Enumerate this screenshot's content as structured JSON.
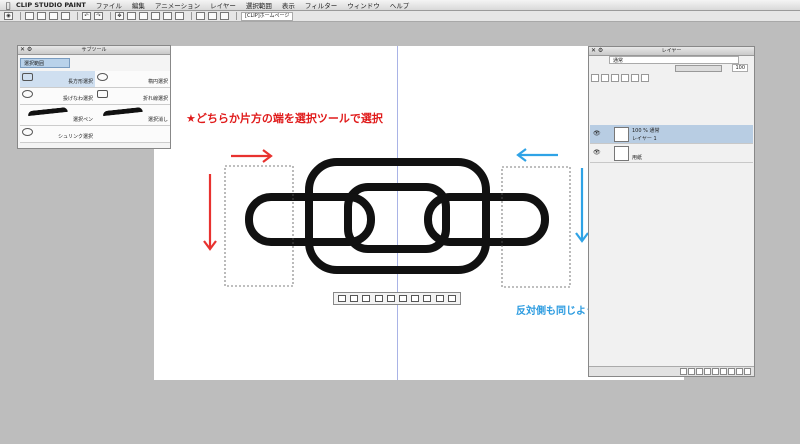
{
  "menubar": {
    "app_name": "CLIP STUDIO PAINT",
    "items": [
      "ファイル",
      "編集",
      "アニメーション",
      "レイヤー",
      "選択範囲",
      "表示",
      "フィルター",
      "ウィンドウ",
      "ヘルプ"
    ]
  },
  "toolbar": {
    "document_tab": "[CLIP]ホームページ"
  },
  "subtool_palette": {
    "title": "サブツール",
    "group_label": "選択範囲",
    "tools": [
      {
        "label": "長方形選択",
        "active": true
      },
      {
        "label": "楕円選択",
        "active": false
      },
      {
        "label": "投げなわ選択",
        "active": false
      },
      {
        "label": "折れ線選択",
        "active": false
      },
      {
        "label": "選択ペン",
        "active": false
      },
      {
        "label": "選択消し",
        "active": false
      },
      {
        "label": "シュリンク選択",
        "active": false
      }
    ]
  },
  "layer_palette": {
    "title": "レイヤー",
    "blend_mode": "通常",
    "opacity": "100",
    "layers": [
      {
        "opacity_mode": "100 % 通常",
        "name": "レイヤー 1",
        "selected": true
      },
      {
        "opacity_mode": "",
        "name": "用紙",
        "selected": false
      }
    ]
  },
  "annotations": {
    "note_top": "★どちらか片方の端を選択ツールで選択",
    "note_bottom": "反対側も同じように選択されます"
  },
  "colors": {
    "red_arrow": "#e8322f",
    "blue_arrow": "#2fa3e6",
    "guide_line": "#a9b3e6"
  }
}
